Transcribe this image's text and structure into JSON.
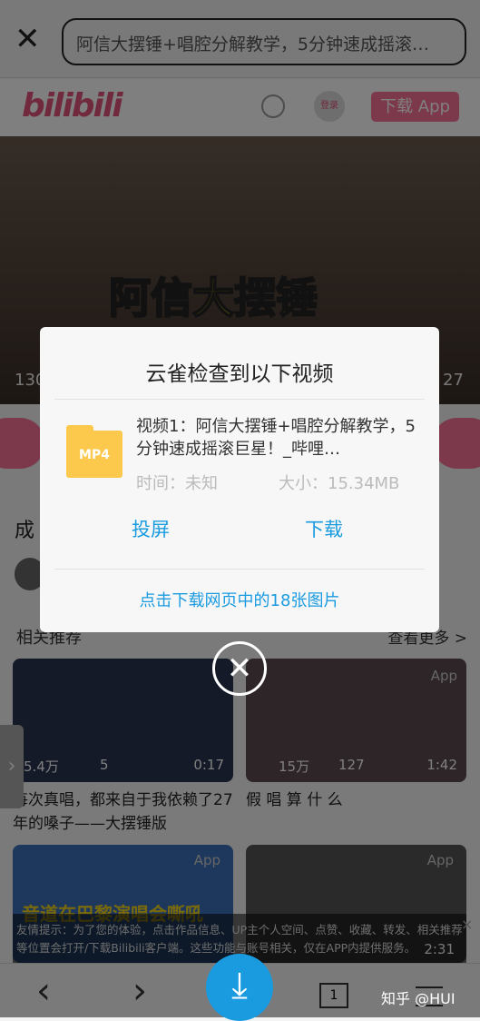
{
  "browser": {
    "url_text": "阿信大摆锤+唱腔分解教学，5分钟速成摇滚…"
  },
  "site": {
    "logo": "bilibili",
    "login": "登录",
    "download_app": "下载 App"
  },
  "video": {
    "overlay_title": "阿信大摆锤",
    "views_partial": "130",
    "duration_partial": "27",
    "title_partial": "成"
  },
  "related": {
    "heading": "相关推荐",
    "more": "查看更多 >",
    "cards": [
      {
        "views": "5.4万",
        "danmaku": "5",
        "duration": "0:17",
        "title": "每次真唱，都来自于我依赖了27年的嗓子——大摆锤版",
        "badge": "App"
      },
      {
        "views": "15万",
        "danmaku": "127",
        "duration": "1:42",
        "title": "假 唱 算 什 么",
        "badge": "App"
      },
      {
        "overlay_title": "音道在巴黎演唱会嘶吼",
        "badge": "App"
      },
      {
        "duration": "2:31",
        "badge": "App"
      }
    ]
  },
  "tip": {
    "text": "友情提示：为了您的体验，点击作品信息、UP主个人空间、点赞、收藏、转发、相关推荐等位置会打开/下载Bilibili客户端。这些功能与账号相关，仅在APP内提供服务。",
    "close": "×"
  },
  "bottom": {
    "tab_count": "1"
  },
  "dialog": {
    "title": "云雀检查到以下视频",
    "file_type": "MP4",
    "video_name": "视频1：阿信大摆锤+唱腔分解教学，5分钟速成摇滚巨星！_哔哩…",
    "time": "时间：未知",
    "size": "大小：15.34MB",
    "cast": "投屏",
    "download": "下载",
    "download_images": "点击下载网页中的18张图片"
  },
  "watermark": "知乎 @HUI"
}
